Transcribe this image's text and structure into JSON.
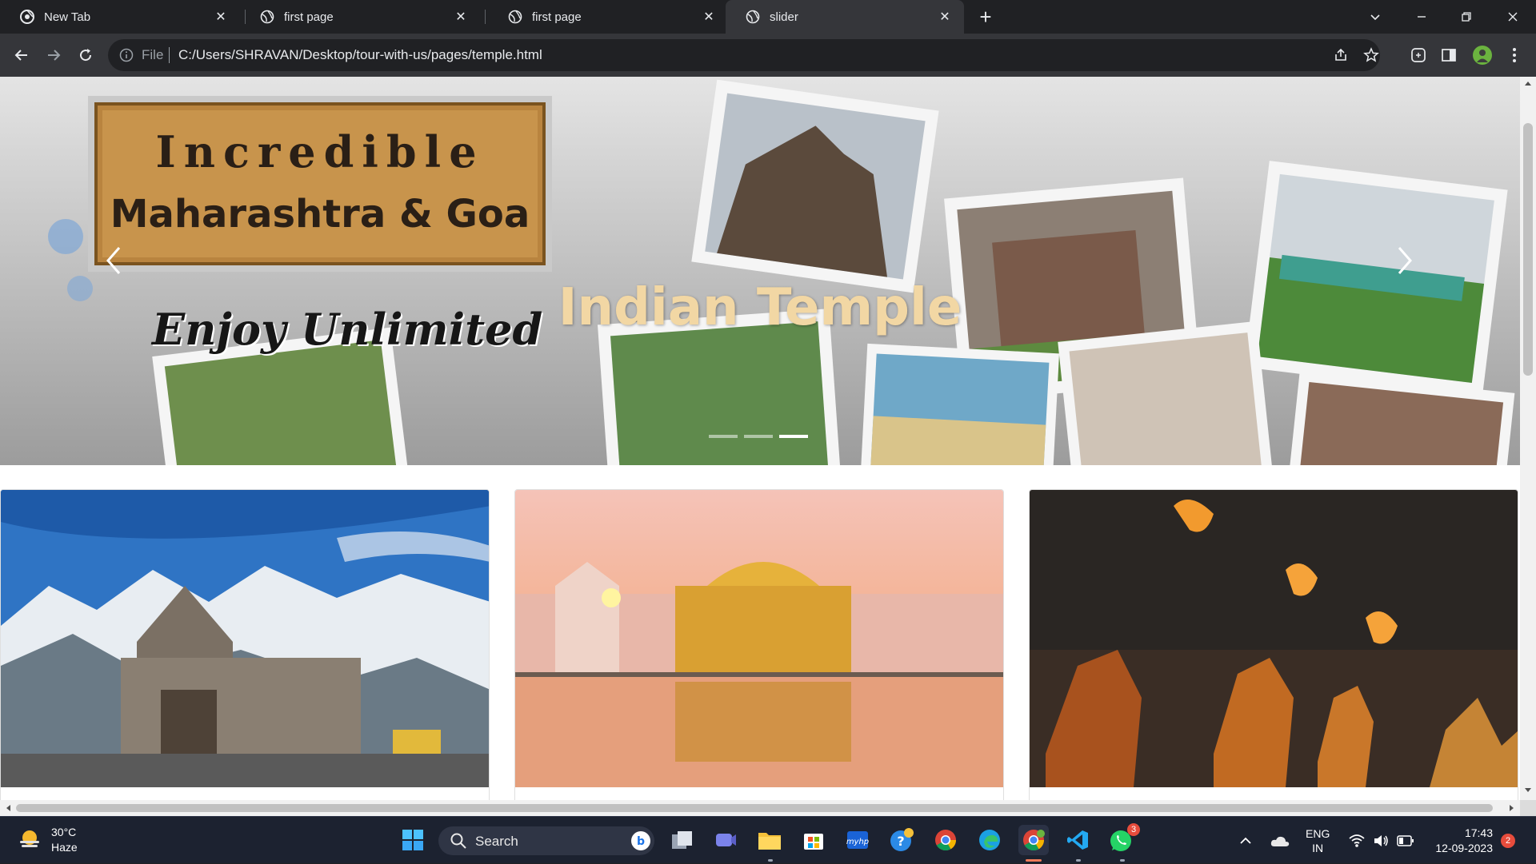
{
  "browser": {
    "tabs": [
      {
        "label": "New Tab",
        "icon": "chrome-icon",
        "active": false
      },
      {
        "label": "first page",
        "icon": "globe-icon",
        "active": false
      },
      {
        "label": "first page",
        "icon": "globe-icon",
        "active": false
      },
      {
        "label": "slider",
        "icon": "globe-icon",
        "active": true
      }
    ],
    "address": {
      "scheme_label": "File",
      "url": "C:/Users/SHRAVAN/Desktop/tour-with-us/pages/temple.html"
    }
  },
  "page": {
    "carousel": {
      "caption": "Indian Temple",
      "slide_text": {
        "line1": "Incredible",
        "line2": "Maharashtra & Goa",
        "line3": "Enjoy Unlimited"
      },
      "indicator_count": 3,
      "active_indicator": 3
    },
    "cards": [
      {
        "subject": "Kedarnath temple with snowy mountains"
      },
      {
        "subject": "Golden Temple reflected in water"
      },
      {
        "subject": "Ganga aarti ceremony with fire lamps"
      }
    ]
  },
  "taskbar": {
    "weather": {
      "temp": "30°C",
      "condition": "Haze"
    },
    "search_label": "Search",
    "language": {
      "lang": "ENG",
      "region": "IN"
    },
    "clock": {
      "time": "17:43",
      "date": "12-09-2023"
    },
    "notification_count": "2",
    "whatsapp_badge": "3"
  }
}
